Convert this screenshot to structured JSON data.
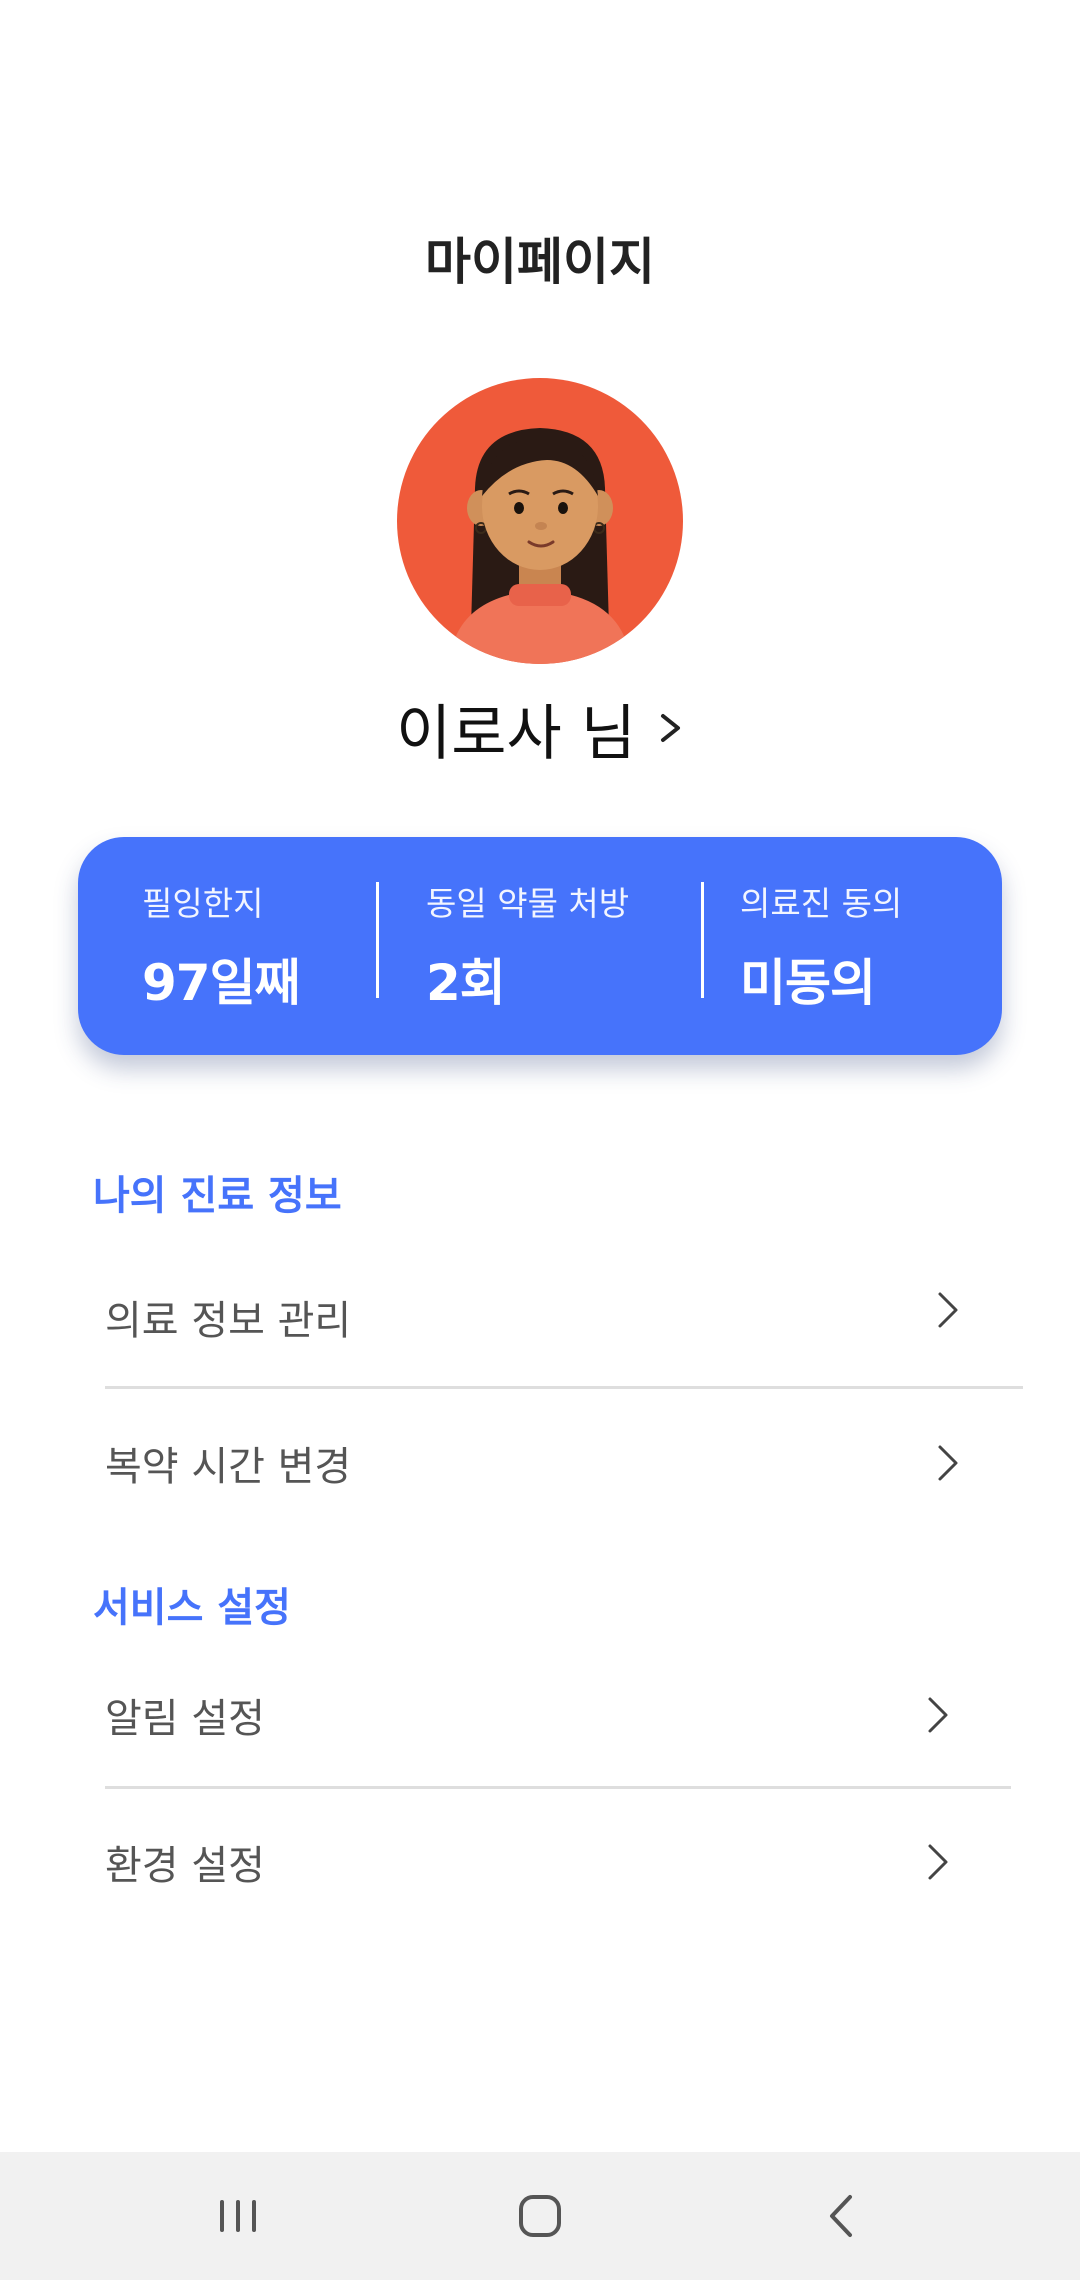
{
  "header": {
    "title": "마이페이지"
  },
  "profile": {
    "name": "이로사 님"
  },
  "stats": [
    {
      "label": "필잉한지",
      "value": "97일째"
    },
    {
      "label": "동일 약물 처방",
      "value": "2회"
    },
    {
      "label": "의료진 동의",
      "value": "미동의"
    }
  ],
  "sections": [
    {
      "title": "나의 진료 정보",
      "items": [
        {
          "label": "의료 정보 관리"
        },
        {
          "label": "복약 시간 변경"
        }
      ]
    },
    {
      "title": "서비스 설정",
      "items": [
        {
          "label": "알림 설정"
        },
        {
          "label": "환경 설정"
        }
      ]
    }
  ],
  "colors": {
    "accent": "#4673fb",
    "avatar_bg": "#ef5a3a",
    "navbar_bg": "#f1f1f1"
  },
  "icons": {
    "chevron": "chevron-right-icon",
    "nav": [
      "recent-apps-icon",
      "home-icon",
      "back-icon"
    ]
  }
}
